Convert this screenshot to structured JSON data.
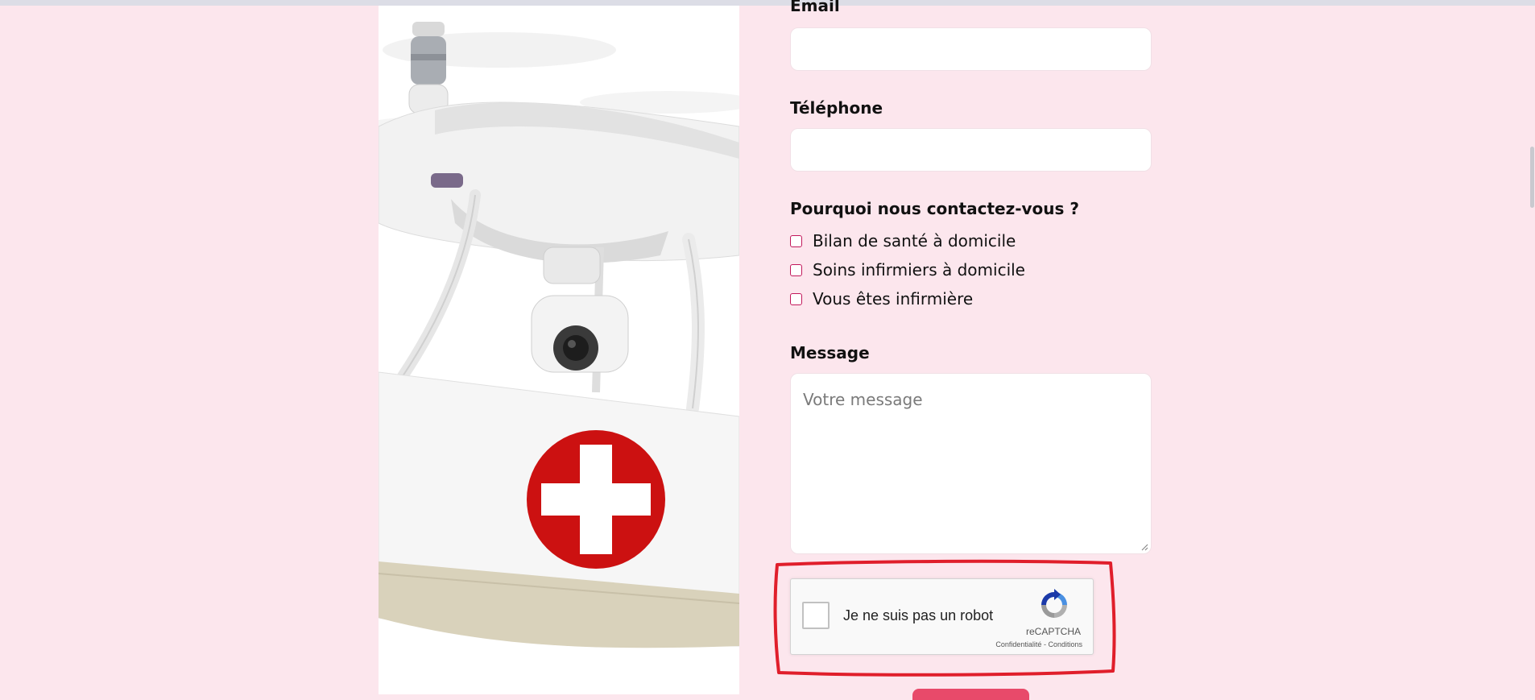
{
  "form": {
    "email_label": "Email",
    "phone_label": "Téléphone",
    "reason_label": "Pourquoi nous contactez-vous ?",
    "reasons": [
      {
        "label": "Bilan de santé à domicile",
        "checked": false
      },
      {
        "label": "Soins infirmiers à domicile",
        "checked": false
      },
      {
        "label": "Vous êtes infirmière",
        "checked": false
      }
    ],
    "message_label": "Message",
    "message_placeholder": "Votre message"
  },
  "recaptcha": {
    "label": "Je ne suis pas un robot",
    "brand": "reCAPTCHA",
    "privacy": "Confidentialité",
    "separator": "-",
    "terms": "Conditions"
  },
  "colors": {
    "background": "#fce6ed",
    "checkbox_border": "#c2185b",
    "highlight": "#e01e2b",
    "button": "#e84a6a",
    "cross_red": "#cc1111"
  },
  "icons": {
    "image": "drone-medical-image",
    "recaptcha": "recaptcha-logo-icon"
  }
}
